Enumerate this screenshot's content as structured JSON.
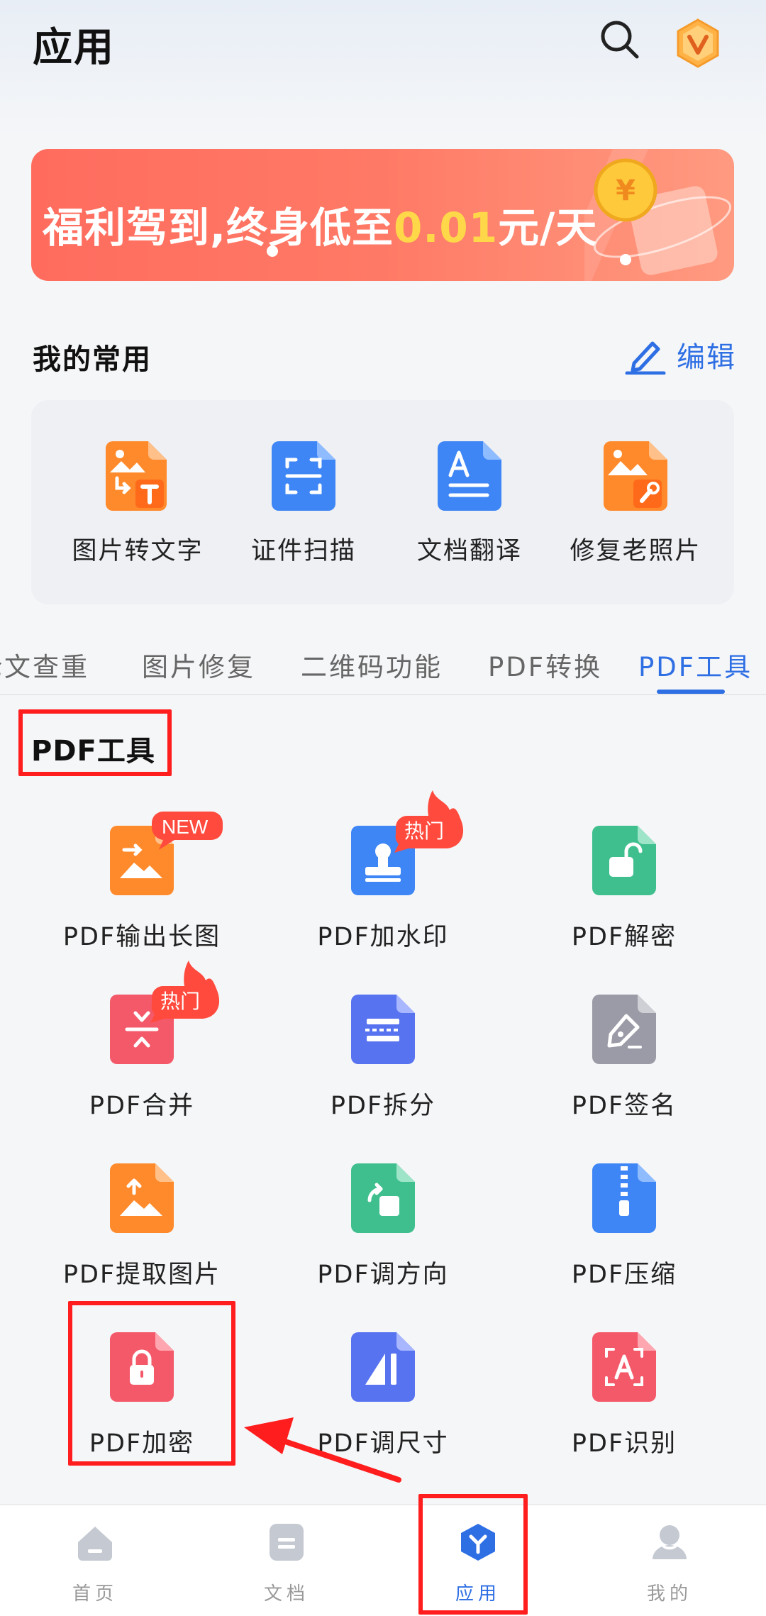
{
  "header": {
    "title": "应用",
    "search_icon": "search-icon",
    "vip_icon": "vip-badge-icon"
  },
  "banner": {
    "text_main": "福利驾到,终身低至",
    "text_highlight": "0.01",
    "text_tail": "元/天",
    "accent": "#ff6c5e",
    "highlight_color": "#ffd84a"
  },
  "favorites": {
    "title": "我的常用",
    "edit_label": "编辑",
    "items": [
      {
        "label": "图片转文字",
        "icon": "image-to-text-icon"
      },
      {
        "label": "证件扫描",
        "icon": "id-scan-icon"
      },
      {
        "label": "文档翻译",
        "icon": "doc-translate-icon"
      },
      {
        "label": "修复老照片",
        "icon": "photo-repair-icon"
      }
    ]
  },
  "tabs": [
    "论文查重",
    "图片修复",
    "二维码功能",
    "PDF转换",
    "PDF工具"
  ],
  "active_tab": "PDF工具",
  "tools": {
    "title": "PDF工具",
    "items": [
      {
        "label": "PDF输出长图",
        "badge": "NEW"
      },
      {
        "label": "PDF加水印",
        "badge": "热门"
      },
      {
        "label": "PDF解密",
        "badge": ""
      },
      {
        "label": "PDF合并",
        "badge": "热门"
      },
      {
        "label": "PDF拆分",
        "badge": ""
      },
      {
        "label": "PDF签名",
        "badge": ""
      },
      {
        "label": "PDF提取图片",
        "badge": ""
      },
      {
        "label": "PDF调方向",
        "badge": ""
      },
      {
        "label": "PDF压缩",
        "badge": ""
      },
      {
        "label": "PDF加密",
        "badge": ""
      },
      {
        "label": "PDF调尺寸",
        "badge": ""
      },
      {
        "label": "PDF识别",
        "badge": ""
      }
    ]
  },
  "bottom_nav": [
    {
      "label": "首页",
      "icon": "home-icon"
    },
    {
      "label": "文档",
      "icon": "document-icon"
    },
    {
      "label": "应用",
      "icon": "apps-icon",
      "active": true
    },
    {
      "label": "我的",
      "icon": "profile-icon"
    }
  ],
  "colors": {
    "primary": "#2f6fe4",
    "annotation_red": "#ff1d1d"
  }
}
